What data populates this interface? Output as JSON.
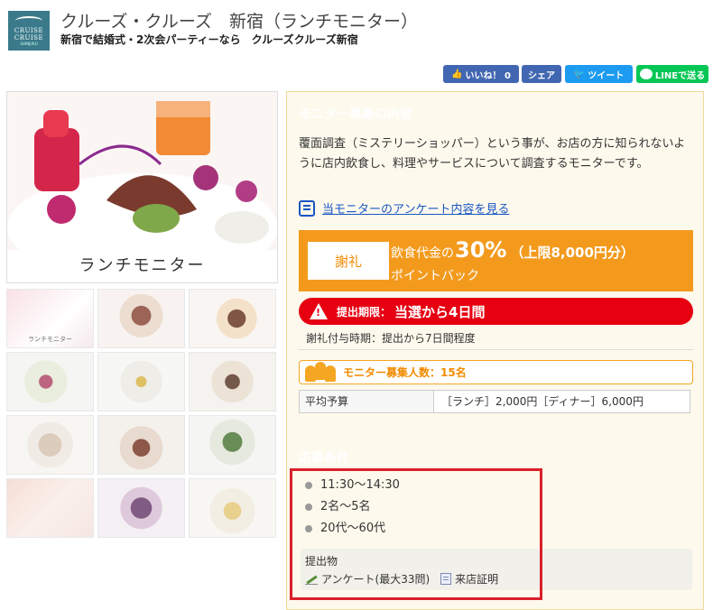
{
  "header": {
    "logo_line1": "CRUISE",
    "logo_line2": "CRUISE",
    "logo_line3": "SHINJUKU",
    "title": "クルーズ・クルーズ　新宿（ランチモニター）",
    "subtitle": "新宿で結婚式・2次会パーティーなら　クルーズクルーズ新宿"
  },
  "social": {
    "like": "いいね！ 0",
    "share": "シェア",
    "tweet": "ツイート",
    "line": "LINEで送る"
  },
  "gallery": {
    "main_caption": "ランチモニター",
    "thumb_caption": "ランチモニター"
  },
  "monitor": {
    "section_title": "モニター募集の内容",
    "description": "覆面調査（ミステリーショッパー）という事が、お店の方に知られないように店内飲食し、料理やサービスについて調査するモニターです。",
    "survey_link": "当モニターのアンケート内容を見る",
    "reward_label": "謝礼",
    "reward_prefix": "飲食代金の",
    "reward_percent": "30%",
    "reward_cap": "（上限8,000円分）",
    "reward_line2": "ポイントバック",
    "deadline_label": "提出期限：",
    "deadline_value": "当選から4日間",
    "timing": "謝礼付与時期：提出から7日間程度",
    "recruit": "モニター募集人数：15名",
    "budget_label": "平均予算",
    "budget_value": "［ランチ］2,000円［ディナー］6,000円"
  },
  "conditions": {
    "section_title": "応募条件",
    "items": [
      "11:30～14:30",
      "2名～5名",
      "20代～60代"
    ],
    "submission_title": "提出物",
    "submission_survey": "アンケート(最大33問)",
    "submission_receipt": "来店証明"
  },
  "colors": {
    "accent_orange": "#f15a22",
    "reward_orange": "#f39a1d",
    "deadline_red": "#e60012",
    "highlight_border": "#d9202a"
  }
}
